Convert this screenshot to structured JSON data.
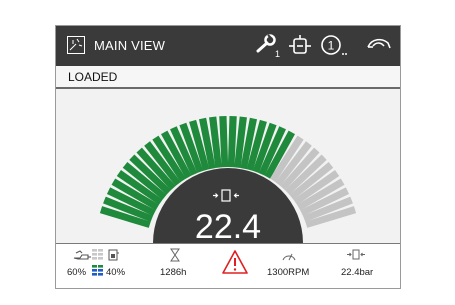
{
  "header": {
    "title": "MAIN VIEW",
    "bar_color": "#3a3a3a",
    "icons": [
      "grid-view-icon",
      "wrench-icon",
      "transmission-icon",
      "info-circle-icon",
      "operator-icon"
    ],
    "wrench_subscript": "1",
    "info_subscript": "1"
  },
  "status": {
    "text": "LOADED"
  },
  "gauge": {
    "value": "22.4",
    "unit_icon": "pressure-icon",
    "total_segments": 34,
    "active_segments": 24,
    "active_color": "#1f8a3b",
    "inactive_color": "#c4c4c4",
    "center_color": "#3a3a3a"
  },
  "footer": {
    "fuel_percent": "60%",
    "def_percent": "40%",
    "hours": "1286h",
    "rpm": "1300RPM",
    "pressure": "22.4bar",
    "warning_color": "#e02020"
  }
}
